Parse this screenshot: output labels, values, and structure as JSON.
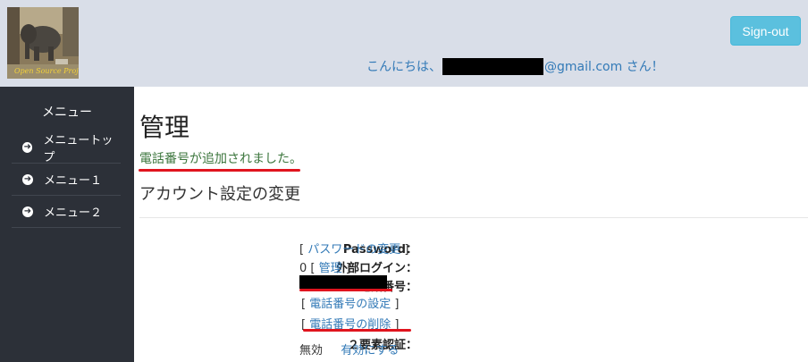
{
  "header": {
    "logo_text": "Open Source Project",
    "signout_label": "Sign-out",
    "greeting_prefix": "こんにちは、",
    "greeting_suffix": "@gmail.com さん！"
  },
  "sidebar": {
    "title": "メニュー",
    "items": [
      {
        "label": "メニュートップ"
      },
      {
        "label": "メニュー１"
      },
      {
        "label": "メニュー２"
      }
    ]
  },
  "main": {
    "title": "管理",
    "status_message": "電話番号が追加されました。",
    "subtitle": "アカウント設定の変更",
    "password_label": "Password：",
    "password_link": "パスワードの変更",
    "external_login_label": "外部ログイン：",
    "external_login_count": "0",
    "external_login_link": "管理",
    "phone_label": "電話番号：",
    "phone_set_link": "電話番号の設定",
    "phone_delete_link": "電話番号の削除",
    "twofactor_label": "２要素認証：",
    "twofactor_status": "無効",
    "twofactor_enable_link": "有効にする"
  },
  "colors": {
    "header_bg": "#d9dee8",
    "sidebar_bg": "#2c3038",
    "link": "#337ab7",
    "success": "#3c763d",
    "signout_bg": "#5bc0de",
    "highlight_underline": "#e0141e"
  }
}
